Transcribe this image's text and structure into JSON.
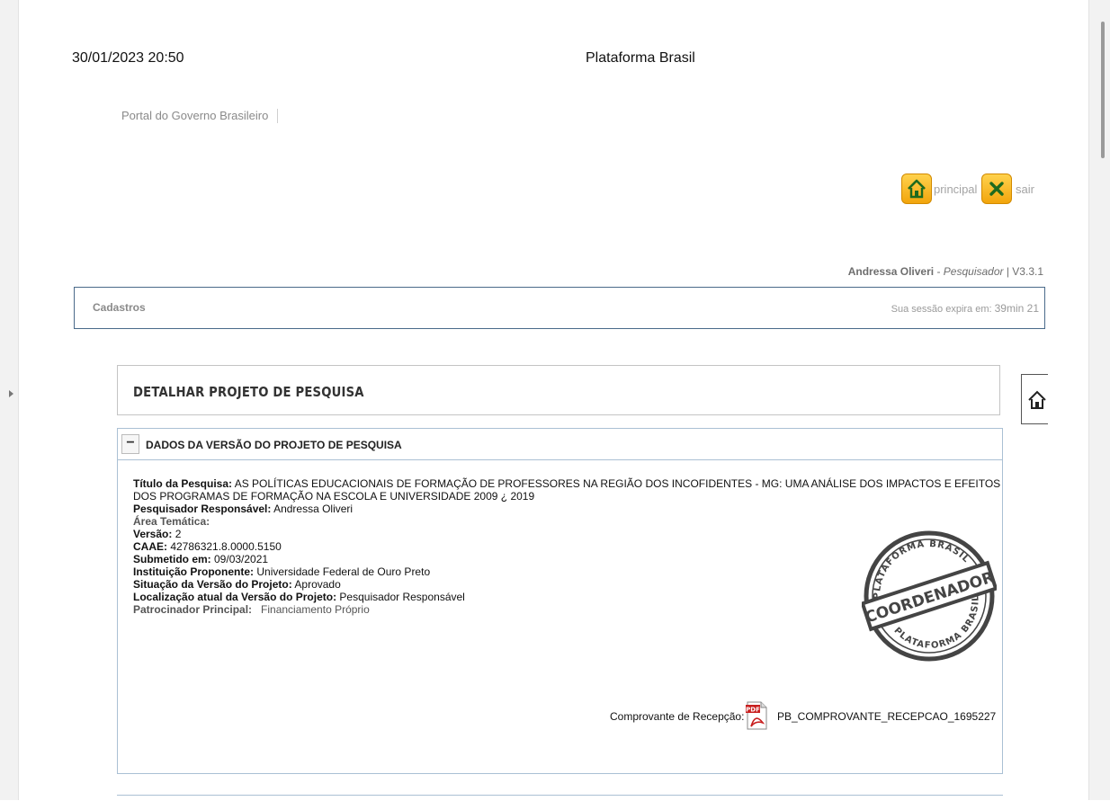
{
  "print_header": {
    "datetime": "30/01/2023 20:50",
    "title": "Plataforma Brasil"
  },
  "gov_bar": {
    "link_label": "Portal do Governo Brasileiro"
  },
  "nav": {
    "principal_label": "principal",
    "sair_label": "sair",
    "accent_color": "#f2a50c"
  },
  "user": {
    "name": "Andressa Oliveri",
    "separator": " - ",
    "role": "Pesquisador",
    "version": " | V3.3.1"
  },
  "menu": {
    "items": [
      "Cadastros"
    ],
    "session_label": "Sua sessão expira em: ",
    "session_timer": "39min 21"
  },
  "page": {
    "title": "DETALHAR PROJETO DE PESQUISA"
  },
  "section": {
    "toggle": "−",
    "title": "DADOS DA VERSÃO DO PROJETO DE PESQUISA",
    "fields": {
      "titulo_label": "Título da Pesquisa:",
      "titulo_value_line1": " AS POLÍTICAS EDUCACIONAIS DE FORMAÇÃO DE PROFESSORES NA REGIÃO DOS INCOFIDENTES - MG: UMA ANÁLISE DOS IMPACTOS E EFEITOS",
      "titulo_value_line2": "DOS PROGRAMAS DE FORMAÇÃO NA ESCOLA E UNIVERSIDADE 2009 ¿ 2019",
      "pesquisador_label": "Pesquisador Responsável:",
      "pesquisador_value": " Andressa Oliveri",
      "area_label": "Área Temática:",
      "versao_label": "Versão:",
      "versao_value": " 2",
      "caae_label": "CAAE:",
      "caae_value": " 42786321.8.0000.5150",
      "submetido_label": "Submetido em:",
      "submetido_value": " 09/03/2021",
      "instituicao_label": "Instituição Proponente:",
      "instituicao_value": " Universidade Federal de Ouro Preto",
      "situacao_label": "Situação da Versão do Projeto:",
      "situacao_value": " Aprovado",
      "localizacao_label": "Localização atual da Versão do Projeto:",
      "localizacao_value": " Pesquisador Responsável",
      "patrocinador_label": "Patrocinador Principal:",
      "patrocinador_value": "   Financiamento Próprio"
    },
    "stamp": {
      "center_text": "COORDENADOR",
      "ring_text": "PLATAFORMA BRASIL"
    },
    "receipt": {
      "label": "Comprovante de Recepção:",
      "pdf_badge": "PDF",
      "file": "PB_COMPROVANTE_RECEPCAO_1695227"
    }
  }
}
